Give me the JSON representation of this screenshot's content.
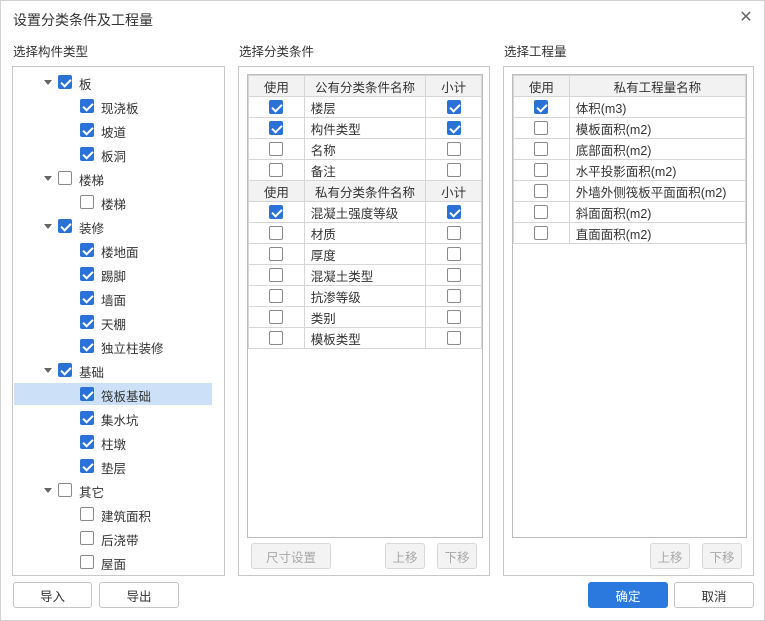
{
  "dialog": {
    "title": "设置分类条件及工程量"
  },
  "sections": {
    "component_type": "选择构件类型",
    "classify": "选择分类条件",
    "quantity": "选择工程量"
  },
  "tree": [
    {
      "label": "板",
      "level": 0,
      "checked": true,
      "expanded": true
    },
    {
      "label": "现浇板",
      "level": 1,
      "checked": true
    },
    {
      "label": "坡道",
      "level": 1,
      "checked": true
    },
    {
      "label": "板洞",
      "level": 1,
      "checked": true
    },
    {
      "label": "楼梯",
      "level": 0,
      "checked": false,
      "expanded": true
    },
    {
      "label": "楼梯",
      "level": 1,
      "checked": false
    },
    {
      "label": "装修",
      "level": 0,
      "checked": true,
      "expanded": true
    },
    {
      "label": "楼地面",
      "level": 1,
      "checked": true
    },
    {
      "label": "踢脚",
      "level": 1,
      "checked": true
    },
    {
      "label": "墙面",
      "level": 1,
      "checked": true
    },
    {
      "label": "天棚",
      "level": 1,
      "checked": true
    },
    {
      "label": "独立柱装修",
      "level": 1,
      "checked": true
    },
    {
      "label": "基础",
      "level": 0,
      "checked": true,
      "expanded": true
    },
    {
      "label": "筏板基础",
      "level": 1,
      "checked": true,
      "selected": true
    },
    {
      "label": "集水坑",
      "level": 1,
      "checked": true
    },
    {
      "label": "柱墩",
      "level": 1,
      "checked": true
    },
    {
      "label": "垫层",
      "level": 1,
      "checked": true
    },
    {
      "label": "其它",
      "level": 0,
      "checked": false,
      "expanded": true
    },
    {
      "label": "建筑面积",
      "level": 1,
      "checked": false
    },
    {
      "label": "后浇带",
      "level": 1,
      "checked": false
    },
    {
      "label": "屋面",
      "level": 1,
      "checked": false
    }
  ],
  "public_table": {
    "headers": [
      "使用",
      "公有分类条件名称",
      "小计"
    ],
    "rows": [
      {
        "use": true,
        "name": "楼层",
        "subtotal": true
      },
      {
        "use": true,
        "name": "构件类型",
        "subtotal": true
      },
      {
        "use": false,
        "name": "名称",
        "subtotal": false
      },
      {
        "use": false,
        "name": "备注",
        "subtotal": false
      }
    ]
  },
  "private_table": {
    "headers": [
      "使用",
      "私有分类条件名称",
      "小计"
    ],
    "rows": [
      {
        "use": true,
        "name": "混凝土强度等级",
        "subtotal": true
      },
      {
        "use": false,
        "name": "材质",
        "subtotal": false
      },
      {
        "use": false,
        "name": "厚度",
        "subtotal": false
      },
      {
        "use": false,
        "name": "混凝土类型",
        "subtotal": false
      },
      {
        "use": false,
        "name": "抗渗等级",
        "subtotal": false
      },
      {
        "use": false,
        "name": "类别",
        "subtotal": false
      },
      {
        "use": false,
        "name": "模板类型",
        "subtotal": false
      }
    ]
  },
  "quantity_table": {
    "headers": [
      "使用",
      "私有工程量名称"
    ],
    "rows": [
      {
        "use": true,
        "name": "体积(m3)"
      },
      {
        "use": false,
        "name": "模板面积(m2)"
      },
      {
        "use": false,
        "name": "底部面积(m2)"
      },
      {
        "use": false,
        "name": "水平投影面积(m2)"
      },
      {
        "use": false,
        "name": "外墙外侧筏板平面面积(m2)"
      },
      {
        "use": false,
        "name": "斜面面积(m2)"
      },
      {
        "use": false,
        "name": "直面面积(m2)"
      }
    ]
  },
  "buttons": {
    "size_settings": "尺寸设置",
    "move_up": "上移",
    "move_down": "下移",
    "import": "导入",
    "export": "导出",
    "ok": "确定",
    "cancel": "取消"
  },
  "colors": {
    "accent": "#2b79de",
    "selected_row": "#cce0f7"
  }
}
